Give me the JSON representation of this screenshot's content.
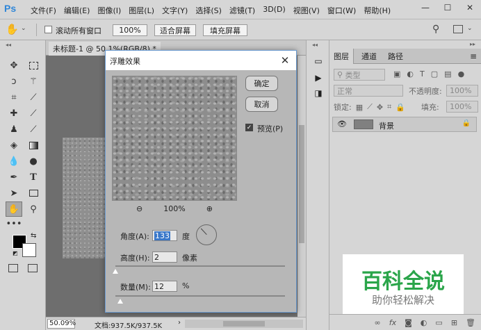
{
  "app": {
    "logo": "Ps"
  },
  "menu": [
    "文件(F)",
    "编辑(E)",
    "图像(I)",
    "图层(L)",
    "文字(Y)",
    "选择(S)",
    "滤镜(T)",
    "3D(D)",
    "视图(V)",
    "窗口(W)",
    "帮助(H)"
  ],
  "window_controls": {
    "minimize": "—",
    "maximize": "☐",
    "close": "✕"
  },
  "options_bar": {
    "hand_icon": "✋",
    "scroll_all_label": "滚动所有窗口",
    "zoom_100": "100%",
    "fit_screen": "适合屏幕",
    "fill_screen": "填充屏幕"
  },
  "document": {
    "tab_title": "未标题-1 @ 50.1%(RGB/8) *",
    "zoom": "50.09%",
    "doc_size": "文档:937.5K/937.5K"
  },
  "layers_panel": {
    "tabs": [
      "图层",
      "通道",
      "路径"
    ],
    "kind_filter": "类型",
    "blend_mode": "正常",
    "opacity_label": "不透明度:",
    "opacity_value": "100%",
    "lock_label": "锁定:",
    "fill_label": "填充:",
    "fill_value": "100%",
    "layer_name": "背景"
  },
  "dialog": {
    "title": "浮雕效果",
    "ok": "确定",
    "cancel": "取消",
    "preview_label": "预览(P)",
    "preview_checked": true,
    "zoom_value": "100%",
    "angle_label": "角度(A):",
    "angle_value": "133",
    "angle_unit": "度",
    "height_label": "高度(H):",
    "height_value": "2",
    "height_unit": "像素",
    "amount_label": "数量(M):",
    "amount_value": "12",
    "amount_unit": "%",
    "height_slider_fraction": 0.0,
    "amount_slider_fraction": 0.03
  },
  "watermark": {
    "title": "百科全说",
    "subtitle": "助你轻松解决"
  },
  "colors": {
    "accent": "#2f86d8",
    "watermark_green": "#2aa54a",
    "selection": "#3a78c9"
  }
}
